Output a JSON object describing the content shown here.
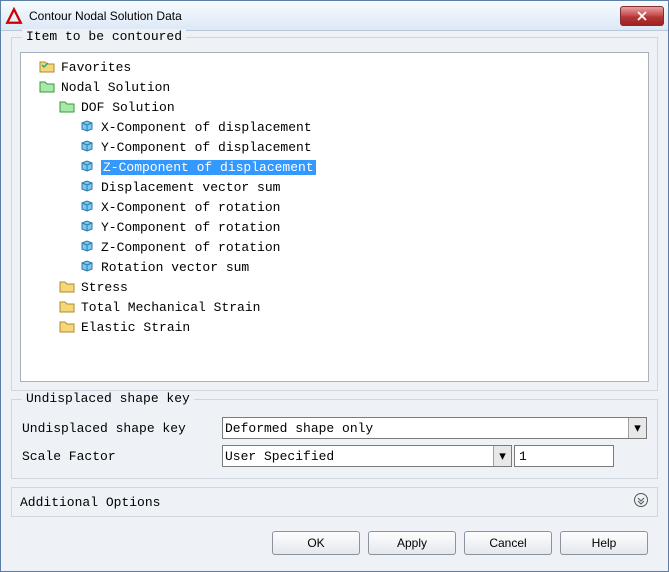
{
  "title": "Contour Nodal Solution Data",
  "group_title": "Item to be contoured",
  "tree": {
    "favorites": "Favorites",
    "nodal_solution": "Nodal Solution",
    "dof_solution": "DOF Solution",
    "x_disp": "X-Component of displacement",
    "y_disp": "Y-Component of displacement",
    "z_disp": "Z-Component of displacement",
    "disp_sum": "Displacement vector sum",
    "x_rot": "X-Component of rotation",
    "y_rot": "Y-Component of rotation",
    "z_rot": "Z-Component of rotation",
    "rot_sum": "Rotation vector sum",
    "stress": "Stress",
    "tms": "Total Mechanical Strain",
    "elastic": "Elastic Strain"
  },
  "shape": {
    "group": "Undisplaced shape key",
    "label1": "Undisplaced shape key",
    "val1": "Deformed shape only",
    "label2": "Scale Factor",
    "val2": "User Specified",
    "scale": "1"
  },
  "additional": "Additional Options",
  "buttons": {
    "ok": "OK",
    "apply": "Apply",
    "cancel": "Cancel",
    "help": "Help"
  }
}
